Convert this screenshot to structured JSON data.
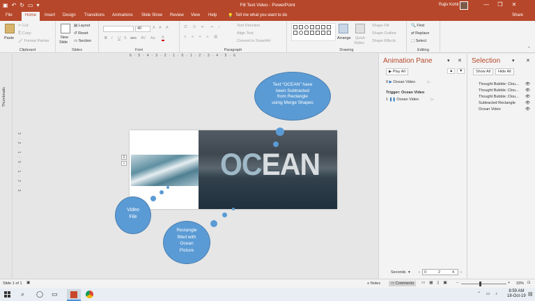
{
  "window": {
    "title": "Fill Text Video  -  PowerPoint",
    "user_name": "Rajiv Kohli",
    "minimize": "—",
    "restore": "❐",
    "close": "✕"
  },
  "ribbon_tabs": [
    {
      "label": "File"
    },
    {
      "label": "Home"
    },
    {
      "label": "Insert"
    },
    {
      "label": "Design"
    },
    {
      "label": "Transitions"
    },
    {
      "label": "Animations"
    },
    {
      "label": "Slide Show"
    },
    {
      "label": "Review"
    },
    {
      "label": "View"
    },
    {
      "label": "Help"
    }
  ],
  "tell_me": "Tell me what you want to do",
  "share": "Share",
  "clipboard": {
    "paste": "Paste",
    "cut": "Cut",
    "copy": "Copy",
    "format_painter": "Format Painter",
    "label": "Clipboard"
  },
  "slides": {
    "new_slide": "New",
    "new_slide2": "Slide",
    "layout": "Layout",
    "reset": "Reset",
    "section": "Section",
    "label": "Slides"
  },
  "font": {
    "size": "40",
    "label": "Font",
    "bold": "B",
    "italic": "I",
    "underline": "U",
    "shadow": "S",
    "strike": "abc",
    "spacing": "AV",
    "case": "Aa",
    "grow": "A",
    "shrink": "A",
    "clear": "A"
  },
  "paragraph": {
    "text_direction": "Text Direction",
    "align_text": "Align Text",
    "convert_smartart": "Convert to SmartArt",
    "label": "Paragraph"
  },
  "drawing": {
    "arrange": "Arrange",
    "quick_styles": "Quick",
    "quick_styles2": "Styles",
    "shape_fill": "Shape Fill",
    "shape_outline": "Shape Outline",
    "shape_effects": "Shape Effects",
    "label": "Drawing"
  },
  "editing": {
    "find": "Find",
    "replace": "Replace",
    "select": "Select",
    "label": "Editing"
  },
  "ruler_top": "6 · 5 · 4 · 3 · 2 · 1 · 0 · 1 · 2 · 3 · 4 · 5 · 6",
  "ruler_left": "3 · 2 · 1 · 0 · 1 · 2 · 3",
  "thumbnails_label": "Thumbnails",
  "slide": {
    "ocean_text_a": "OC",
    "ocean_text_b": "EAN",
    "video_marker": "0",
    "bubble_top": [
      "Text “OCEAN” have",
      "been Subtracted",
      "from Rectangle",
      "using Merge Shapes"
    ],
    "bubble_video": [
      "Video",
      "File"
    ],
    "bubble_rect": [
      "Rectangle",
      "filled with",
      "Ocean",
      "Picture"
    ]
  },
  "animation_pane": {
    "title": "Animation Pane",
    "play_all": "Play All",
    "items": [
      {
        "index": "0",
        "name": "Ocean Video"
      }
    ],
    "trigger_label": "Trigger: Ocean Video",
    "trigger_items": [
      {
        "index": "1",
        "name": "Ocean Video"
      }
    ],
    "seconds_label": "Seconds",
    "timeline": [
      "0",
      "2",
      "4"
    ]
  },
  "selection_pane": {
    "title": "Selection",
    "show_all": "Show All",
    "hide_all": "Hide All",
    "items": [
      {
        "name": "Thought Bubble: Clou..."
      },
      {
        "name": "Thought Bubble: Clou..."
      },
      {
        "name": "Thought Bubble: Clou..."
      },
      {
        "name": "Subtracted Rectangle"
      },
      {
        "name": "Ocean Video"
      }
    ]
  },
  "status": {
    "slide_of": "Slide 1 of 1",
    "notes": "Notes",
    "comments": "Comments",
    "zoom": "33%"
  },
  "taskbar": {
    "time": "8:59 AM",
    "date": "18-Oct-19"
  },
  "colors": {
    "accent": "#b7472a",
    "cloud": "#5b9bd5"
  }
}
